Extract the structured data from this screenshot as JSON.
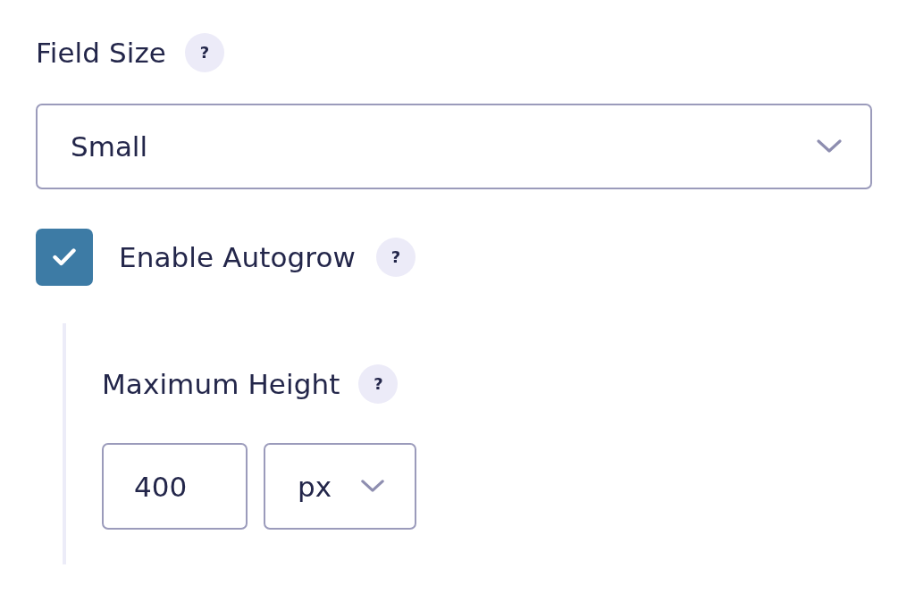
{
  "field_size": {
    "label": "Field Size",
    "help": "?",
    "select": {
      "value": "Small"
    }
  },
  "autogrow": {
    "label": "Enable Autogrow",
    "checked": true,
    "help": "?"
  },
  "maximum_height": {
    "label": "Maximum Height",
    "help": "?",
    "value": "400",
    "unit": "px"
  }
}
